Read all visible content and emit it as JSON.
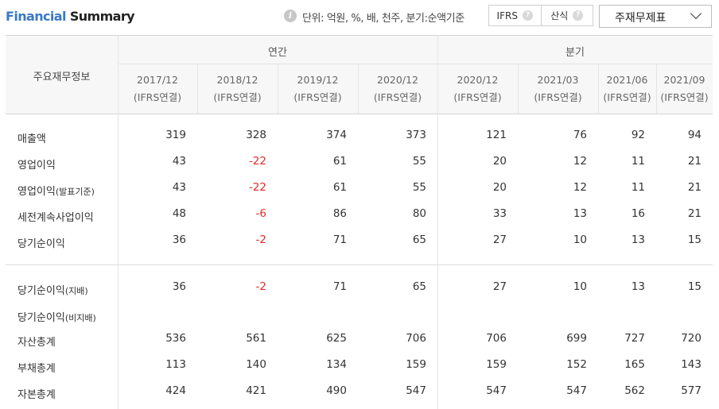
{
  "header": {
    "title_part1": "Financial",
    "title_part2": "Summary",
    "unit_text": "단위: 억원, %, 배, 천주, 분기:순액기준",
    "toggle_ifrs": "IFRS",
    "toggle_formula": "산식",
    "help_glyph": "?",
    "info_glyph": "i",
    "statement_select": "주재무제표"
  },
  "table": {
    "corner_label": "주요재무정보",
    "group_annual": "연간",
    "group_quarter": "분기",
    "columns": [
      {
        "period": "2017/12",
        "basis": "(IFRS연결)"
      },
      {
        "period": "2018/12",
        "basis": "(IFRS연결)"
      },
      {
        "period": "2019/12",
        "basis": "(IFRS연결)"
      },
      {
        "period": "2020/12",
        "basis": "(IFRS연결)"
      },
      {
        "period": "2020/12",
        "basis": "(IFRS연결)"
      },
      {
        "period": "2021/03",
        "basis": "(IFRS연결)"
      },
      {
        "period": "2021/06",
        "basis": "(IFRS연결)"
      },
      {
        "period": "2021/09",
        "basis": "(IFRS연결)"
      }
    ],
    "rows": [
      {
        "label": "매출액",
        "sub": "",
        "values": [
          "319",
          "328",
          "374",
          "373",
          "121",
          "76",
          "92",
          "94"
        ]
      },
      {
        "label": "영업이익",
        "sub": "",
        "values": [
          "43",
          "-22",
          "61",
          "55",
          "20",
          "12",
          "11",
          "21"
        ]
      },
      {
        "label": "영업이익",
        "sub": "(발표기준)",
        "values": [
          "43",
          "-22",
          "61",
          "55",
          "20",
          "12",
          "11",
          "21"
        ]
      },
      {
        "label": "세전계속사업이익",
        "sub": "",
        "values": [
          "48",
          "-6",
          "86",
          "80",
          "33",
          "13",
          "16",
          "21"
        ]
      },
      {
        "label": "당기순이익",
        "sub": "",
        "values": [
          "36",
          "-2",
          "71",
          "65",
          "27",
          "10",
          "13",
          "15"
        ]
      },
      {
        "label": "당기순이익",
        "sub": "(지배)",
        "values": [
          "36",
          "-2",
          "71",
          "65",
          "27",
          "10",
          "13",
          "15"
        ]
      },
      {
        "label": "당기순이익",
        "sub": "(비지배)",
        "values": [
          "",
          "",
          "",
          "",
          "",
          "",
          "",
          ""
        ]
      },
      {
        "label": "자산총계",
        "sub": "",
        "values": [
          "536",
          "561",
          "625",
          "706",
          "706",
          "699",
          "727",
          "720"
        ]
      },
      {
        "label": "부채총계",
        "sub": "",
        "values": [
          "113",
          "140",
          "134",
          "159",
          "159",
          "152",
          "165",
          "143"
        ]
      },
      {
        "label": "자본총계",
        "sub": "",
        "values": [
          "424",
          "421",
          "490",
          "547",
          "547",
          "547",
          "562",
          "577"
        ]
      }
    ]
  },
  "colors": {
    "title_accent": "#3a78c9",
    "negative": "#e22a2a",
    "header_bg": "#f7f7f7"
  }
}
